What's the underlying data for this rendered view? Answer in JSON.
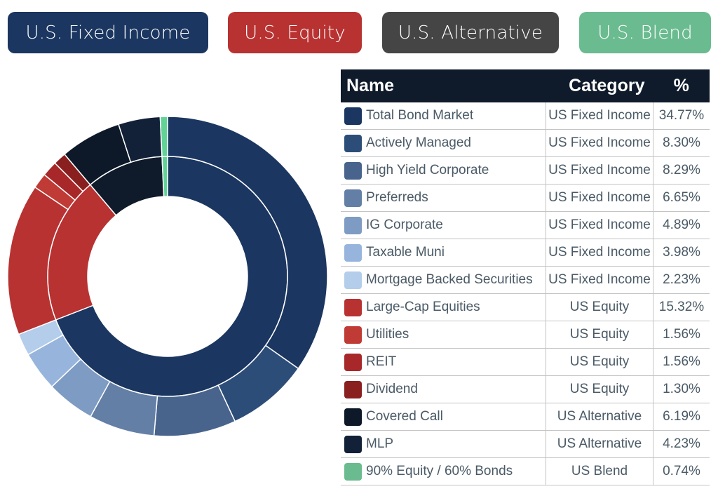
{
  "category_buttons": [
    {
      "label": "U.S. Fixed Income",
      "color": "#1b3660"
    },
    {
      "label": "U.S. Equity",
      "color": "#b83232"
    },
    {
      "label": "U.S. Alternative",
      "color": "#454545"
    },
    {
      "label": "U.S. Blend",
      "color": "#6bbb90"
    }
  ],
  "legend": {
    "headers": {
      "name": "Name",
      "category": "Category",
      "percent": "%"
    },
    "rows": [
      {
        "name": "Total Bond Market",
        "category": "US Fixed Income",
        "percent": "34.77%",
        "color": "#1b3660"
      },
      {
        "name": "Actively Managed",
        "category": "US Fixed Income",
        "percent": "8.30%",
        "color": "#2d4d79"
      },
      {
        "name": "High Yield Corporate",
        "category": "US Fixed Income",
        "percent": "8.29%",
        "color": "#48648c"
      },
      {
        "name": "Preferreds",
        "category": "US Fixed Income",
        "percent": "6.65%",
        "color": "#637fa6"
      },
      {
        "name": "IG Corporate",
        "category": "US Fixed Income",
        "percent": "4.89%",
        "color": "#7d9bc3"
      },
      {
        "name": "Taxable Muni",
        "category": "US Fixed Income",
        "percent": "3.98%",
        "color": "#97b5dc"
      },
      {
        "name": "Mortgage Backed Securities",
        "category": "US Fixed Income",
        "percent": "2.23%",
        "color": "#b3cdeb"
      },
      {
        "name": "Large-Cap Equities",
        "category": "US Equity",
        "percent": "15.32%",
        "color": "#b83232"
      },
      {
        "name": "Utilities",
        "category": "US Equity",
        "percent": "1.56%",
        "color": "#c03a36"
      },
      {
        "name": "REIT",
        "category": "US Equity",
        "percent": "1.56%",
        "color": "#a8282a"
      },
      {
        "name": "Dividend",
        "category": "US Equity",
        "percent": "1.30%",
        "color": "#8a1f20"
      },
      {
        "name": "Covered Call",
        "category": "US Alternative",
        "percent": "6.19%",
        "color": "#0d1828"
      },
      {
        "name": "MLP",
        "category": "US Alternative",
        "percent": "4.23%",
        "color": "#122038"
      },
      {
        "name": "90% Equity / 60% Bonds",
        "category": "US Blend",
        "percent": "0.74%",
        "color": "#6bbb90"
      }
    ]
  },
  "chart_data": {
    "type": "pie",
    "subtype": "two-level donut (sunburst)",
    "title": "",
    "direction": "clockwise from top",
    "inner_ring": [
      {
        "name": "US Fixed Income",
        "value": 69.11,
        "color": "#1b3660"
      },
      {
        "name": "US Equity",
        "value": 19.74,
        "color": "#b83232"
      },
      {
        "name": "US Alternative",
        "value": 10.42,
        "color": "#0f1a2a"
      },
      {
        "name": "US Blend",
        "value": 0.74,
        "color": "#62d397"
      }
    ],
    "outer_ring": [
      {
        "name": "Total Bond Market",
        "category": "US Fixed Income",
        "value": 34.77,
        "color": "#1b3660"
      },
      {
        "name": "Actively Managed",
        "category": "US Fixed Income",
        "value": 8.3,
        "color": "#2d4d79"
      },
      {
        "name": "High Yield Corporate",
        "category": "US Fixed Income",
        "value": 8.29,
        "color": "#48648c"
      },
      {
        "name": "Preferreds",
        "category": "US Fixed Income",
        "value": 6.65,
        "color": "#637fa6"
      },
      {
        "name": "IG Corporate",
        "category": "US Fixed Income",
        "value": 4.89,
        "color": "#7d9bc3"
      },
      {
        "name": "Taxable Muni",
        "category": "US Fixed Income",
        "value": 3.98,
        "color": "#97b5dc"
      },
      {
        "name": "Mortgage Backed Securities",
        "category": "US Fixed Income",
        "value": 2.23,
        "color": "#b3cdeb"
      },
      {
        "name": "Large-Cap Equities",
        "category": "US Equity",
        "value": 15.32,
        "color": "#b83232"
      },
      {
        "name": "Utilities",
        "category": "US Equity",
        "value": 1.56,
        "color": "#c03a36"
      },
      {
        "name": "REIT",
        "category": "US Equity",
        "value": 1.56,
        "color": "#a8282a"
      },
      {
        "name": "Dividend",
        "category": "US Equity",
        "value": 1.3,
        "color": "#8a1f20"
      },
      {
        "name": "Covered Call",
        "category": "US Alternative",
        "value": 6.19,
        "color": "#0d1828"
      },
      {
        "name": "MLP",
        "category": "US Alternative",
        "value": 4.23,
        "color": "#122038"
      },
      {
        "name": "90% Equity / 60% Bonds",
        "category": "US Blend",
        "value": 0.74,
        "color": "#62d397"
      }
    ]
  }
}
